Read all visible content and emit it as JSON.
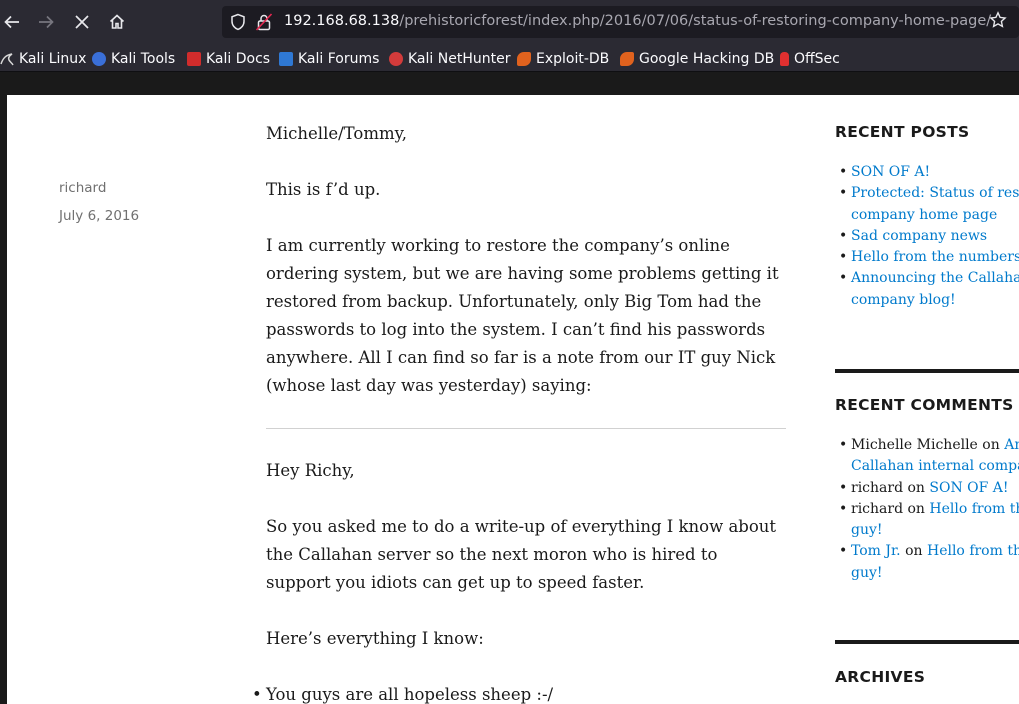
{
  "browser": {
    "url_host": "192.168.68.138",
    "url_path": "/prehistoricforest/index.php/2016/07/06/status-of-restoring-company-home-page/"
  },
  "bookmarks": [
    {
      "label": "Kali Linux",
      "icon": "kali-dragon-icon",
      "color": "#3b3b3b"
    },
    {
      "label": "Kali Tools",
      "icon": "kali-tools-icon",
      "color": "#3a6fd8"
    },
    {
      "label": "Kali Docs",
      "icon": "kali-docs-icon",
      "color": "#d12c2c"
    },
    {
      "label": "Kali Forums",
      "icon": "kali-forums-icon",
      "color": "#2f78d4"
    },
    {
      "label": "Kali NetHunter",
      "icon": "nethunter-icon",
      "color": "#d33b3b"
    },
    {
      "label": "Exploit-DB",
      "icon": "exploit-db-icon",
      "color": "#e0621e"
    },
    {
      "label": "Google Hacking DB",
      "icon": "ghdb-icon",
      "color": "#e0621e"
    },
    {
      "label": "OffSec",
      "icon": "offsec-icon",
      "color": "#e03030"
    }
  ],
  "post": {
    "author": "richard",
    "date": "July 6, 2016",
    "greeting": "Michelle/Tommy,",
    "p1": "This is f’d up.",
    "p2": "I am currently working to restore the company’s online ordering system, but we are having some problems getting it restored from backup.  Unfortunately, only Big Tom had the passwords to log into the system.  I can’t find his passwords anywhere.  All I can find so far is a note from our IT guy Nick (whose last day was yesterday) saying:",
    "note_greeting": "Hey Richy,",
    "note_p1": "So you asked me to do a write-up of everything I know about the Callahan server so the next moron who is hired to support you idiots can get up to speed faster.",
    "note_p2": "Here’s everything I know:",
    "note_bullet1": "You guys are all hopeless sheep :-/"
  },
  "sidebar": {
    "recent_posts_title": "RECENT POSTS",
    "recent_posts": [
      "SON OF A!",
      "Protected: Status of restor",
      "company home page",
      "Sad company news",
      "Hello from the numbers gu",
      "Announcing the Callahan i",
      "company blog!"
    ],
    "recent_comments_title": "RECENT COMMENTS",
    "comments": [
      {
        "author": "Michelle Michelle",
        "on": "on",
        "link": "Anno",
        "link2": "Callahan internal company"
      },
      {
        "author": "richard",
        "on": "on",
        "link": "SON OF A!"
      },
      {
        "author": "richard",
        "on": "on",
        "link": "Hello from the n",
        "link2": "guy!"
      },
      {
        "author": "Tom Jr.",
        "on": "on",
        "link": "Hello from the n",
        "link2": "guy!",
        "author_is_link": true
      }
    ],
    "archives_title": "ARCHIVES"
  },
  "colors": {
    "link": "#007acc",
    "chrome": "#2b2a33",
    "urlbar": "#1c1b22"
  }
}
